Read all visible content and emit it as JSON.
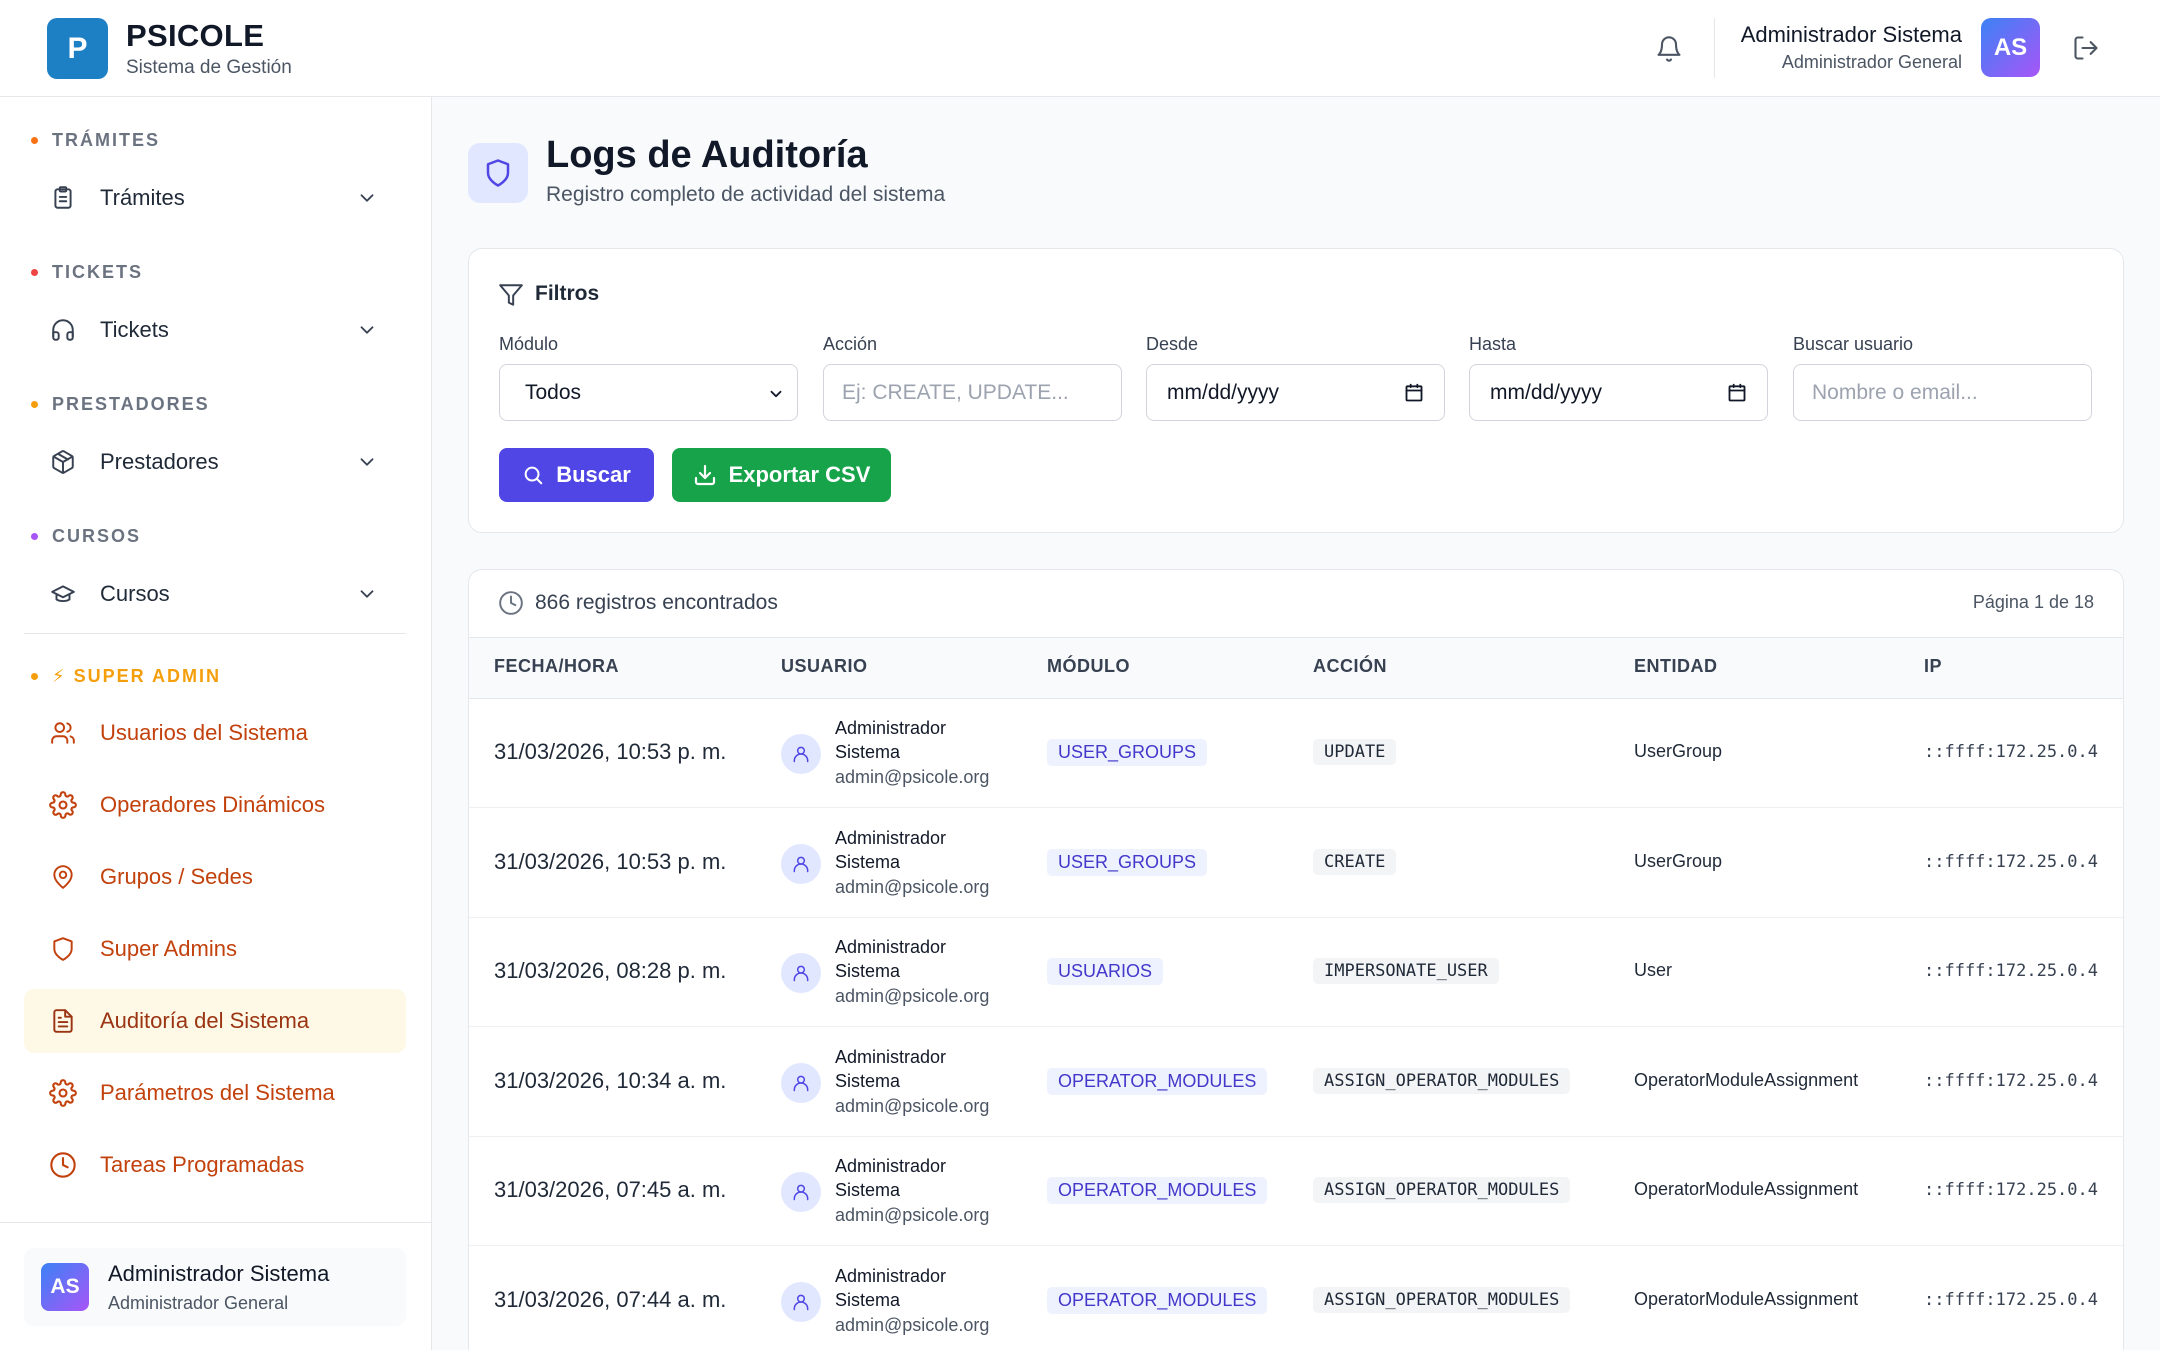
{
  "header": {
    "logo_letter": "P",
    "brand_name": "PSICOLE",
    "brand_sub": "Sistema de Gestión",
    "user_name": "Administrador Sistema",
    "user_role": "Administrador General",
    "avatar_initials": "AS"
  },
  "sidebar": {
    "sections": [
      {
        "label": "TRÁMITES",
        "dot_color": "#f97316",
        "item": "Trámites",
        "icon": "clipboard-icon"
      },
      {
        "label": "TICKETS",
        "dot_color": "#ef4444",
        "item": "Tickets",
        "icon": "headphones-icon"
      },
      {
        "label": "PRESTADORES",
        "dot_color": "#f59e0b",
        "item": "Prestadores",
        "icon": "package-icon"
      },
      {
        "label": "CURSOS",
        "dot_color": "#a855f7",
        "item": "Cursos",
        "icon": "graduation-cap-icon"
      }
    ],
    "super_admin": {
      "label": "⚡ SUPER ADMIN",
      "dot_color": "#f59e0b",
      "items": [
        {
          "label": "Usuarios del Sistema",
          "icon": "users-icon"
        },
        {
          "label": "Operadores Dinámicos",
          "icon": "gear-icon"
        },
        {
          "label": "Grupos / Sedes",
          "icon": "map-pin-icon"
        },
        {
          "label": "Super Admins",
          "icon": "shield-icon"
        },
        {
          "label": "Auditoría del Sistema",
          "icon": "file-text-icon",
          "active": true
        },
        {
          "label": "Parámetros del Sistema",
          "icon": "gear-icon"
        },
        {
          "label": "Tareas Programadas",
          "icon": "clock-icon"
        }
      ]
    },
    "footer": {
      "avatar_initials": "AS",
      "user_name": "Administrador Sistema",
      "user_role": "Administrador General"
    }
  },
  "page": {
    "title": "Logs de Auditoría",
    "subtitle": "Registro completo de actividad del sistema"
  },
  "filters": {
    "title": "Filtros",
    "modulo": {
      "label": "Módulo",
      "value": "Todos"
    },
    "accion": {
      "label": "Acción",
      "placeholder": "Ej: CREATE, UPDATE..."
    },
    "desde": {
      "label": "Desde",
      "value": "mm/dd/yyyy"
    },
    "hasta": {
      "label": "Hasta",
      "value": "mm/dd/yyyy"
    },
    "usuario": {
      "label": "Buscar usuario",
      "placeholder": "Nombre o email..."
    },
    "search_button": "Buscar",
    "export_button": "Exportar CSV",
    "colors": {
      "search": "#4f46e5",
      "export": "#16a34a"
    }
  },
  "results": {
    "count_text": "866 registros encontrados",
    "page_text": "Página 1 de 18",
    "columns": [
      "FECHA/HORA",
      "USUARIO",
      "MÓDULO",
      "ACCIÓN",
      "ENTIDAD",
      "IP"
    ],
    "rows": [
      {
        "date": "31/03/2026, 10:53 p. m.",
        "user_name": "Administrador Sistema",
        "user_email": "admin@psicole.org",
        "module": "USER_GROUPS",
        "action": "UPDATE",
        "entity": "UserGroup",
        "ip": "::ffff:172.25.0.4"
      },
      {
        "date": "31/03/2026, 10:53 p. m.",
        "user_name": "Administrador Sistema",
        "user_email": "admin@psicole.org",
        "module": "USER_GROUPS",
        "action": "CREATE",
        "entity": "UserGroup",
        "ip": "::ffff:172.25.0.4"
      },
      {
        "date": "31/03/2026, 08:28 p. m.",
        "user_name": "Administrador Sistema",
        "user_email": "admin@psicole.org",
        "module": "USUARIOS",
        "action": "IMPERSONATE_USER",
        "entity": "User",
        "ip": "::ffff:172.25.0.4"
      },
      {
        "date": "31/03/2026, 10:34 a. m.",
        "user_name": "Administrador Sistema",
        "user_email": "admin@psicole.org",
        "module": "OPERATOR_MODULES",
        "action": "ASSIGN_OPERATOR_MODULES",
        "entity": "OperatorModuleAssignment",
        "ip": "::ffff:172.25.0.4"
      },
      {
        "date": "31/03/2026, 07:45 a. m.",
        "user_name": "Administrador Sistema",
        "user_email": "admin@psicole.org",
        "module": "OPERATOR_MODULES",
        "action": "ASSIGN_OPERATOR_MODULES",
        "entity": "OperatorModuleAssignment",
        "ip": "::ffff:172.25.0.4"
      },
      {
        "date": "31/03/2026, 07:44 a. m.",
        "user_name": "Administrador Sistema",
        "user_email": "admin@psicole.org",
        "module": "OPERATOR_MODULES",
        "action": "ASSIGN_OPERATOR_MODULES",
        "entity": "OperatorModuleAssignment",
        "ip": "::ffff:172.25.0.4"
      }
    ]
  }
}
